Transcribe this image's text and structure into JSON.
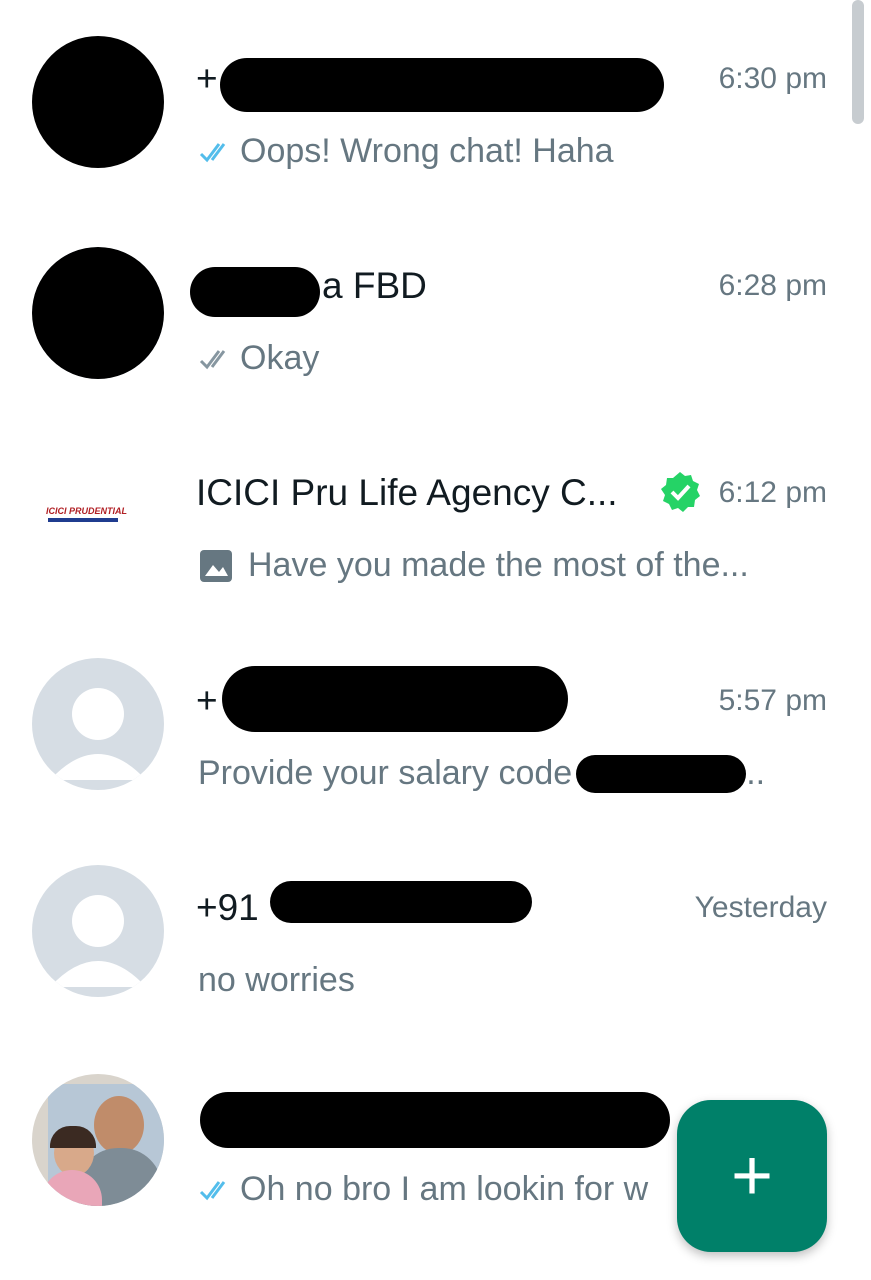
{
  "chats": [
    {
      "name": "+",
      "time": "6:30 pm",
      "preview": "Oops! Wrong chat! Haha",
      "ticks": "read",
      "avatar": "redacted"
    },
    {
      "name": "a FBD",
      "time": "6:28 pm",
      "preview": "Okay",
      "ticks": "delivered",
      "avatar": "redacted-photo"
    },
    {
      "name": "ICICI Pru Life Agency C...",
      "time": "6:12 pm",
      "preview": "Have you made the most of the...",
      "verified": true,
      "avatar": "icici-logo",
      "logo_text": "ICICI PRUDENTIAL"
    },
    {
      "name": "+",
      "time": "5:57 pm",
      "preview": "Provide your salary code ",
      "preview_tail": "..",
      "avatar": "default"
    },
    {
      "name": "+91 ",
      "time": "Yesterday",
      "preview": "no worries",
      "avatar": "default"
    },
    {
      "name": "",
      "time": "",
      "preview": "Oh no bro I am lookin for w",
      "ticks": "read",
      "avatar": "photo"
    }
  ],
  "fab": {
    "label": "+",
    "icon": "new-chat-icon"
  },
  "colors": {
    "accent": "#008069",
    "read_tick": "#53bdeb",
    "delivered_tick": "#8696a0",
    "verified": "#25d366",
    "secondary_text": "#667781",
    "primary_text": "#111b21"
  }
}
